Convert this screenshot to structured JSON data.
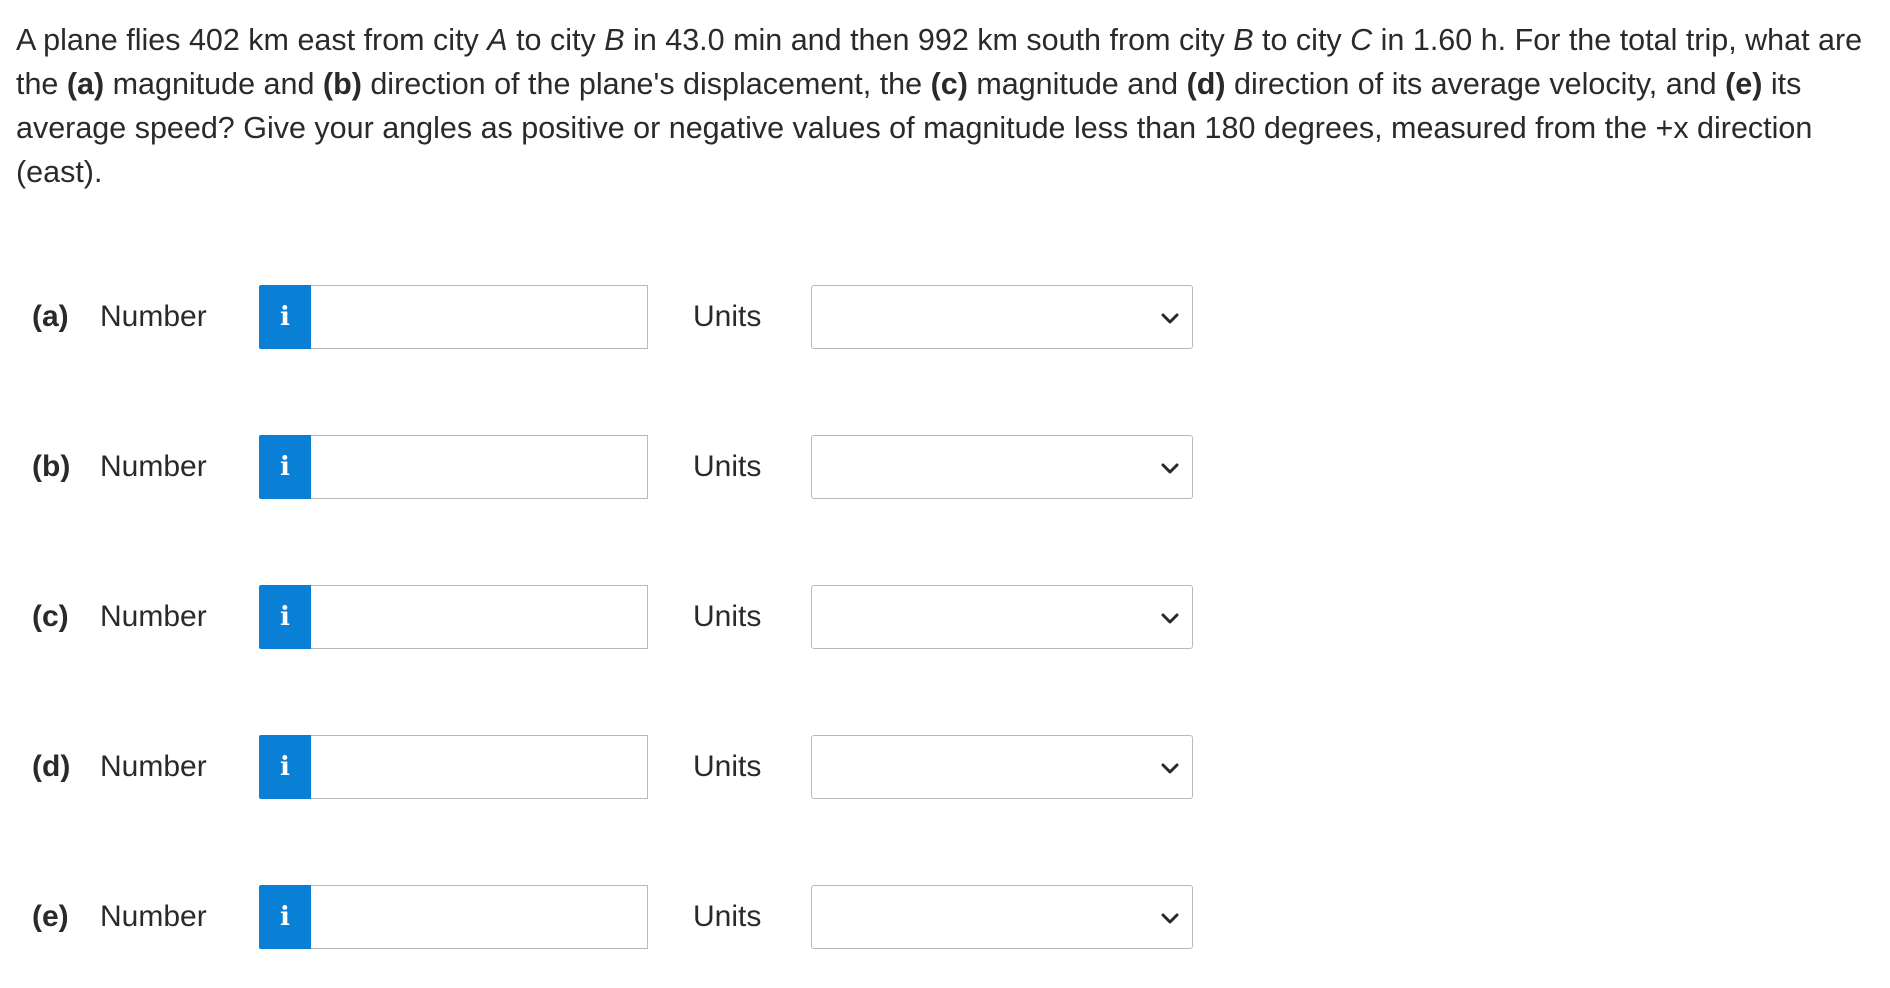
{
  "question": {
    "p1": "A plane flies 402 km east from city ",
    "cityA": "A",
    "p2": " to city ",
    "cityB1": "B",
    "p3": " in 43.0 min and then 992 km south from city ",
    "cityB2": "B",
    "p4": " to city ",
    "cityC": "C",
    "p5": " in 1.60 h. For the total trip, what are the ",
    "a": "(a)",
    "p6": " magnitude and ",
    "b": "(b)",
    "p7": " direction of the plane's displacement, the ",
    "c": "(c)",
    "p8": " magnitude and ",
    "d": "(d)",
    "p9": " direction of its average velocity, and ",
    "e": "(e)",
    "p10": " its average speed? Give your angles as positive or negative values of magnitude less than 180 degrees, measured from the +x direction (east)."
  },
  "parts": [
    {
      "label": "(a)",
      "number_label": "Number",
      "info": "i",
      "value": "",
      "units_label": "Units",
      "units_value": ""
    },
    {
      "label": "(b)",
      "number_label": "Number",
      "info": "i",
      "value": "",
      "units_label": "Units",
      "units_value": ""
    },
    {
      "label": "(c)",
      "number_label": "Number",
      "info": "i",
      "value": "",
      "units_label": "Units",
      "units_value": ""
    },
    {
      "label": "(d)",
      "number_label": "Number",
      "info": "i",
      "value": "",
      "units_label": "Units",
      "units_value": ""
    },
    {
      "label": "(e)",
      "number_label": "Number",
      "info": "i",
      "value": "",
      "units_label": "Units",
      "units_value": ""
    }
  ],
  "colors": {
    "info_button": "#0a7fd6",
    "border": "#b9b9b9",
    "text": "#2a2a2a"
  },
  "icons": {
    "info": "info-icon",
    "dropdown": "chevron-down-icon"
  }
}
